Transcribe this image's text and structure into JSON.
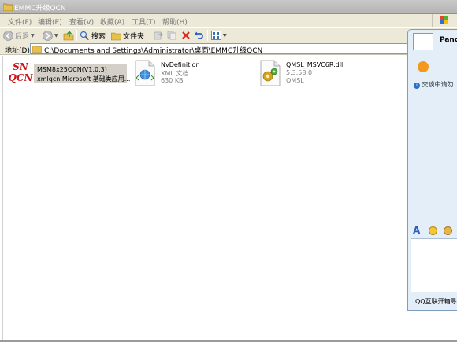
{
  "window": {
    "title": "EMMC升级QCN"
  },
  "menu": [
    {
      "label": "文件(F)"
    },
    {
      "label": "编辑(E)"
    },
    {
      "label": "查看(V)"
    },
    {
      "label": "收藏(A)"
    },
    {
      "label": "工具(T)"
    },
    {
      "label": "帮助(H)"
    }
  ],
  "toolbar": {
    "back": "后退",
    "search": "搜索",
    "folders": "文件夹"
  },
  "address": {
    "label": "地址(D)",
    "path": "C:\\Documents and Settings\\Administrator\\桌面\\EMMC升级QCN"
  },
  "files": [
    {
      "name": "MSM8x25QCN(V1.0.3)",
      "detail": "xmlqcn Microsoft 基础类应用...",
      "logo_line1": "SN",
      "logo_line2": "QCN"
    },
    {
      "name": "NvDefinition",
      "type": "XML 文档",
      "size": "630 KB"
    },
    {
      "name": "QMSL_MSVC6R.dll",
      "version": "5.3.58.0",
      "desc": "QMSL"
    }
  ],
  "qq": {
    "name": "Panda",
    "tip": "交谈中请勿",
    "footer": "QQ互联开箱寻"
  }
}
